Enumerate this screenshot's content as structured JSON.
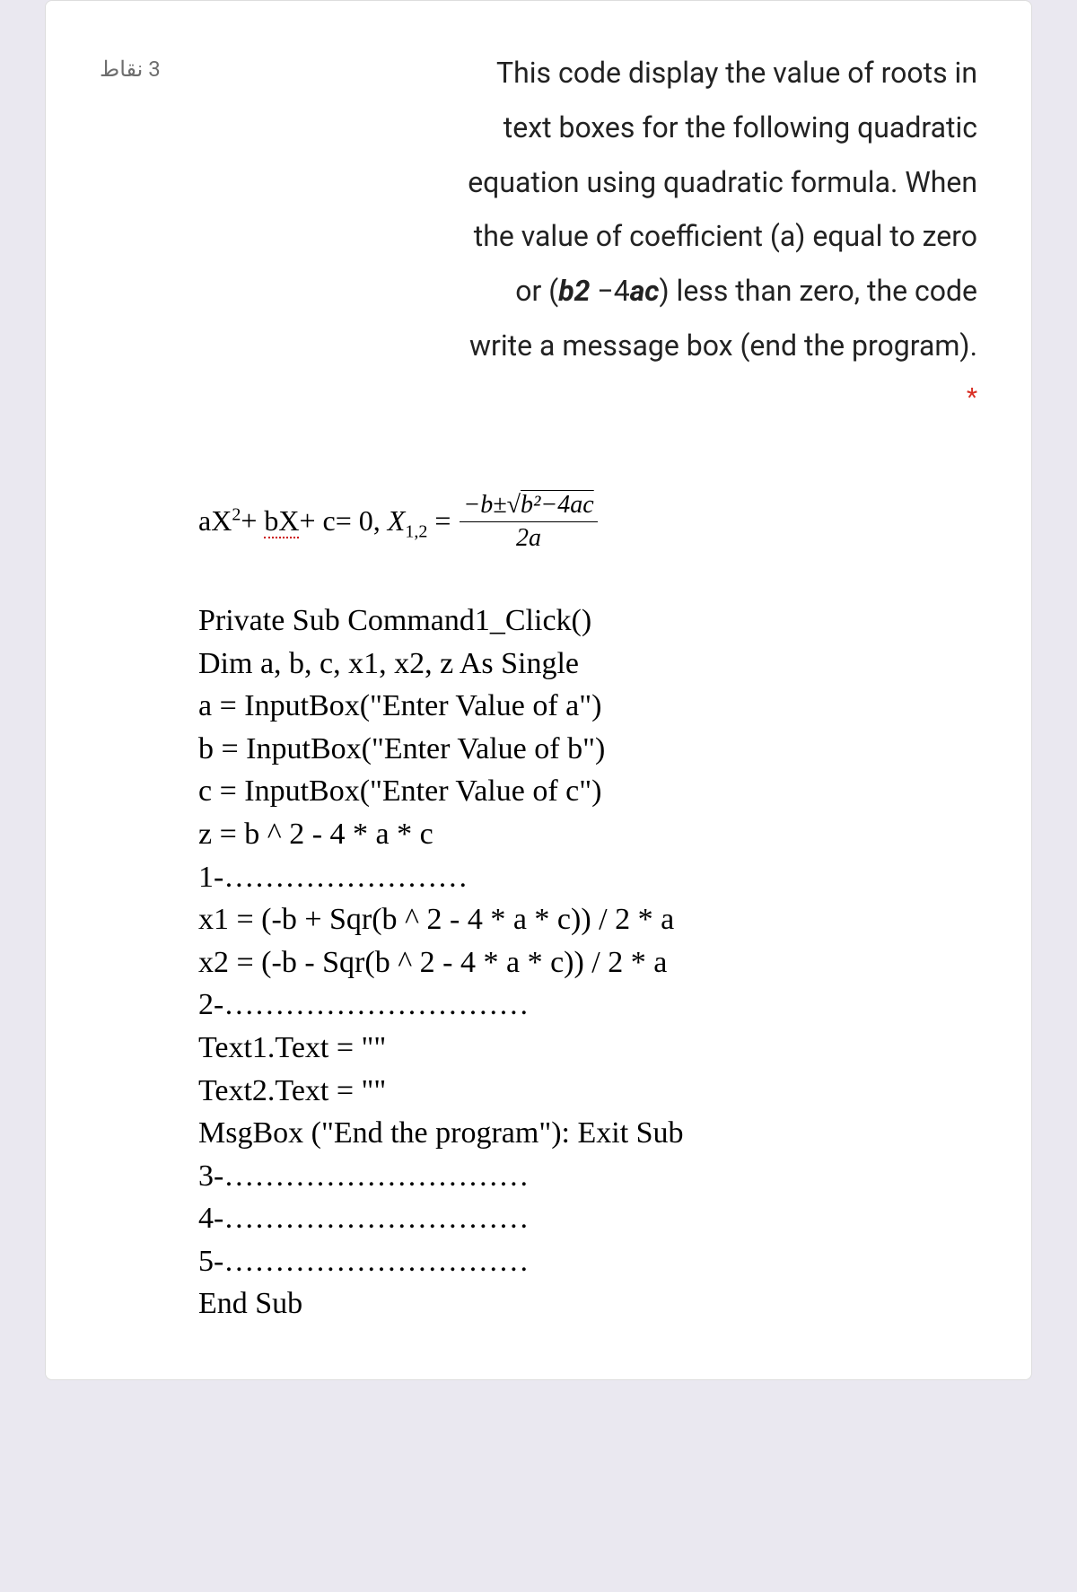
{
  "points": "3 نقاط",
  "question": {
    "line1": "This code display the value of roots in",
    "line2": "text boxes for the following quadratic",
    "line3": "equation using quadratic formula. When",
    "line4": "the value of coefficient (a) equal to zero",
    "line5_pre": "or (",
    "line5_bold1": "b2",
    "line5_mid": " −4",
    "line5_bold2": "ac",
    "line5_post": ") less than zero, the code",
    "line6": "write a message box (end the program).",
    "star": "*"
  },
  "formula": {
    "lhs": "aX²+ bX+ c= 0, X",
    "sub": "1,2",
    "eq": " =",
    "num_pre": "−b±",
    "num_sqrt": "√",
    "num_rad": "b²−4ac",
    "den": "2a"
  },
  "code": {
    "l1": "Private Sub Command1_Click()",
    "l2": "Dim a, b, c, x1, x2, z As Single",
    "l3": "a = InputBox(\"Enter Value of a\")",
    "l4": "b = InputBox(\"Enter Value of b\")",
    "l5": "c = InputBox(\"Enter Value of c\")",
    "l6": "z = b ^ 2 - 4 * a * c",
    "l7": "1-……………………",
    "l8": "x1 = (-b + Sqr(b ^ 2 - 4 * a * c)) / 2 * a",
    "l9": "x2 = (-b - Sqr(b ^ 2 - 4 * a * c)) / 2 * a",
    "l10": "2-…………………………",
    "l11": "Text1.Text = \"\"",
    "l12": "Text2.Text = \"\"",
    "l13": "MsgBox (\"End the program\"): Exit Sub",
    "l14": "3-…………………………",
    "l15": "4-…………………………",
    "l16": "5-…………………………",
    "l17": "End Sub"
  }
}
